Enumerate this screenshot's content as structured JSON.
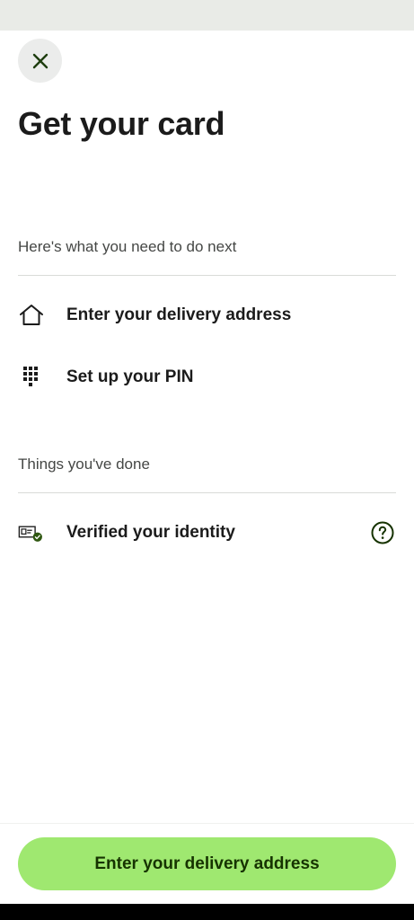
{
  "header": {
    "title": "Get your card"
  },
  "todo": {
    "heading": "Here's what you need to do next",
    "items": [
      {
        "label": "Enter your delivery address",
        "icon": "home-icon"
      },
      {
        "label": "Set up your PIN",
        "icon": "keypad-icon"
      }
    ]
  },
  "done": {
    "heading": "Things you've done",
    "items": [
      {
        "label": "Verified your identity",
        "icon": "id-card-check-icon",
        "help_icon": "question-circle-icon"
      }
    ]
  },
  "footer": {
    "cta_label": "Enter your delivery address"
  },
  "colors": {
    "accent": "#9fe870",
    "cta_text": "#163300",
    "success": "#2f5711",
    "close_bg": "#ebeceb"
  }
}
